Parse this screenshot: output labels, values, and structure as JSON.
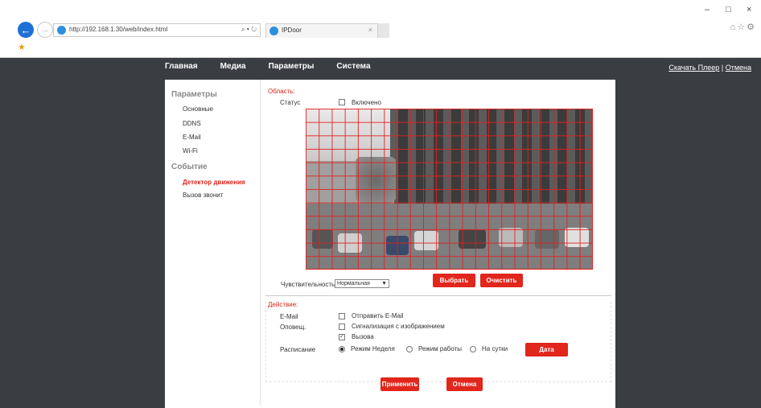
{
  "browser": {
    "url": "http://192.168.1.30/web/index.html",
    "address_tools": "⌕ ▾ ↻",
    "tab_title": "IPDoor",
    "tab_close": "×",
    "back_glyph": "←",
    "forward_glyph": "→",
    "minimize": "–",
    "restore": "□",
    "close": "×",
    "toolbar_icons": "⌂☆⚙"
  },
  "header": {
    "nav": [
      "Главная",
      "Медиа",
      "Параметры",
      "Система"
    ],
    "link_player": "Скачать Плеер",
    "separator": "|",
    "link_cancel": "Отмена"
  },
  "sidebar": {
    "group1": "Параметры",
    "items1": [
      "Основные",
      "DDNS",
      "E-Mail",
      "Wi-Fi"
    ],
    "group2": "Событие",
    "items2": [
      "Детектор движения",
      "Вызов звонит"
    ]
  },
  "area": {
    "title": "Область:",
    "status_label": "Статус",
    "enabled_label": "Включено",
    "enabled_checked": false,
    "select_button": "Выбрать",
    "clear_button": "Очистить",
    "sensitivity_label": "Чувствительность",
    "sensitivity_value": "Нормальная"
  },
  "action": {
    "title": "Действие:",
    "email_label": "E-Mail",
    "email_option": "Отправить E-Mail",
    "alarm_label": "Оповещ.",
    "alarm_option_1": "Сигнализация с изображением",
    "alarm_option_2": "Вызова",
    "alarm_option_2_checked": true,
    "schedule_label": "Расписание",
    "schedule_options": [
      "Режим Неделя",
      "Режим работы",
      "На сутки"
    ],
    "schedule_selected": "Режим Неделя",
    "date_button": "Дата"
  },
  "footer": {
    "apply_button": "Применить",
    "cancel_button": "Отмена"
  },
  "colors": {
    "accent": "#e1261c",
    "page_bg": "#3a3d42"
  }
}
